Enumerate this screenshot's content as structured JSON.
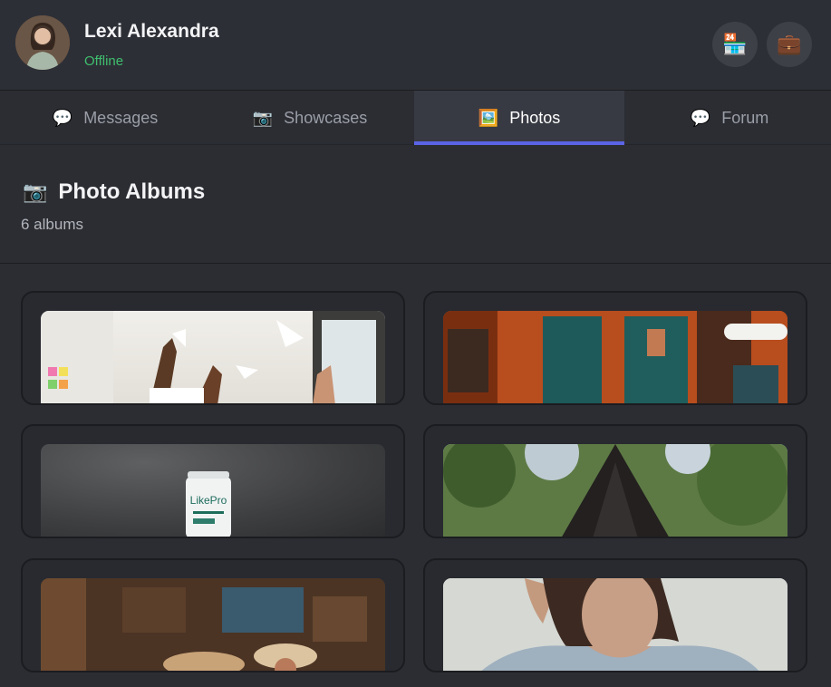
{
  "profile": {
    "name": "Lexi Alexandra",
    "status": "Offline",
    "status_color": "#3fbf6e"
  },
  "header_buttons": [
    {
      "icon": "store-icon",
      "glyph": "🏪"
    },
    {
      "icon": "briefcase-icon",
      "glyph": "💼"
    }
  ],
  "tabs": [
    {
      "label": "Messages",
      "icon": "speech-bubble-icon",
      "glyph": "💬"
    },
    {
      "label": "Showcases",
      "icon": "camera-icon",
      "glyph": "📷"
    },
    {
      "label": "Photos",
      "icon": "framed-picture-icon",
      "glyph": "🖼️",
      "active": true
    },
    {
      "label": "Forum",
      "icon": "speech-bubble-icon",
      "glyph": "💬"
    }
  ],
  "albums": {
    "title": "Photo Albums",
    "title_glyph": "📷",
    "count_label": "6 albums"
  },
  "colors": {
    "accent": "#5b63e6",
    "background": "#2b2d33"
  }
}
